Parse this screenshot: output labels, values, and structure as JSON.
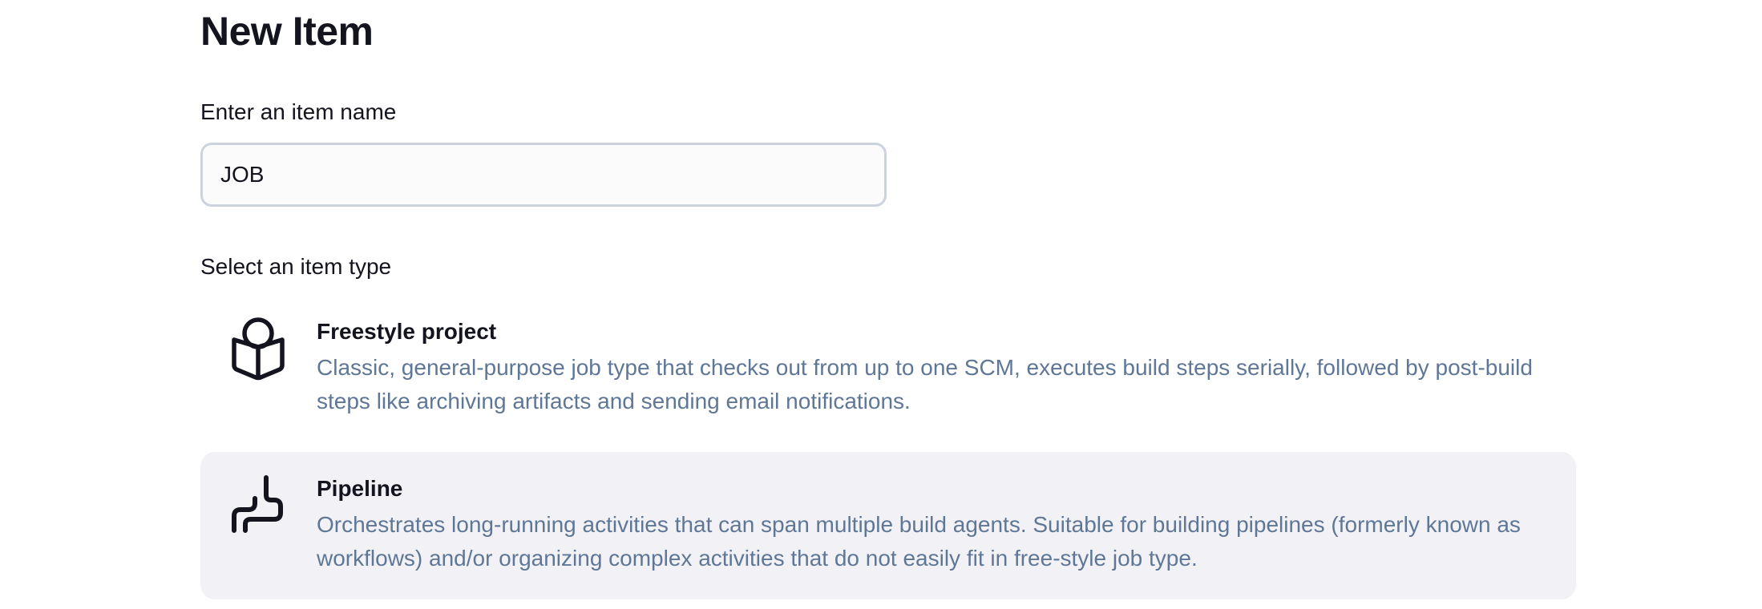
{
  "page": {
    "title": "New Item"
  },
  "name_field": {
    "label": "Enter an item name",
    "value": "JOB",
    "placeholder": ""
  },
  "item_types": {
    "label": "Select an item type",
    "items": [
      {
        "name": "Freestyle project",
        "description": "Classic, general-purpose job type that checks out from up to one SCM, executes build steps serially, followed by post-build steps like archiving artifacts and sending email notifications.",
        "icon": "package-box-icon",
        "selected": false
      },
      {
        "name": "Pipeline",
        "description": "Orchestrates long-running activities that can span multiple build agents. Suitable for building pipelines (formerly known as workflows) and/or organizing complex activities that do not easily fit in free-style job type.",
        "icon": "pipeline-icon",
        "selected": true
      }
    ]
  },
  "colors": {
    "text": "#14141f",
    "description": "#5f7796",
    "input_border": "#cdd3dc",
    "selected_background": "#f2f2f6"
  }
}
